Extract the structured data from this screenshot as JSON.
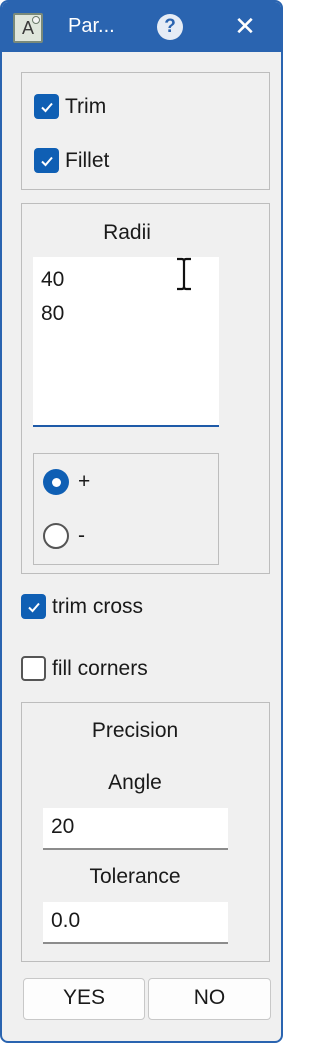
{
  "titlebar": {
    "app_icon_letter": "A",
    "title": "Par...",
    "help_glyph": "?",
    "close_glyph": "✕"
  },
  "options": {
    "trim_label": "Trim",
    "trim_checked": true,
    "fillet_label": "Fillet",
    "fillet_checked": true
  },
  "radii": {
    "title": "Radii",
    "values": [
      "40",
      "80"
    ],
    "sign_options": [
      {
        "label": "+",
        "selected": true
      },
      {
        "label": "-",
        "selected": false
      }
    ]
  },
  "extras": {
    "trim_cross_label": "trim cross",
    "trim_cross_checked": true,
    "fill_corners_label": "fill corners",
    "fill_corners_checked": false
  },
  "precision": {
    "title": "Precision",
    "angle_label": "Angle",
    "angle_value": "20",
    "tolerance_label": "Tolerance",
    "tolerance_value": "0.0"
  },
  "buttons": {
    "yes": "YES",
    "no": "NO"
  },
  "colors": {
    "accent": "#0f5fb4",
    "titlebar": "#2a64b0"
  }
}
